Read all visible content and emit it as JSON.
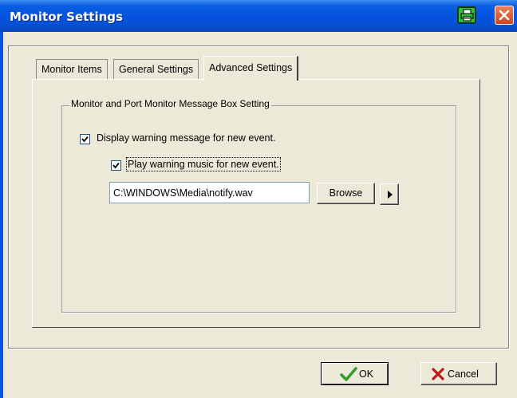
{
  "window": {
    "title": "Monitor Settings"
  },
  "tabs": [
    {
      "label": "Monitor Items"
    },
    {
      "label": "General Settings"
    },
    {
      "label": "Advanced Settings",
      "active": true
    }
  ],
  "groupbox": {
    "label": "Monitor and Port Monitor Message Box Setting"
  },
  "options": {
    "display_warning": {
      "label": "Display warning message for new event.",
      "checked": true
    },
    "play_music": {
      "label": "Play warning music for new event.",
      "checked": true
    }
  },
  "sound_file": {
    "value": "C:\\WINDOWS\\Media\\notify.wav"
  },
  "buttons": {
    "browse": "Browse",
    "ok": "OK",
    "cancel": "Cancel"
  },
  "colors": {
    "title_bar": "#0554e2",
    "dialog_bg": "#ece9d8",
    "close_button": "#d0451b",
    "ok_check": "#2e9d2e",
    "cancel_x": "#c01818"
  },
  "icons": {
    "titlebar_app": "printer-icon",
    "close": "close-icon",
    "play": "play-icon",
    "ok": "checkmark-icon",
    "cancel": "x-icon"
  }
}
